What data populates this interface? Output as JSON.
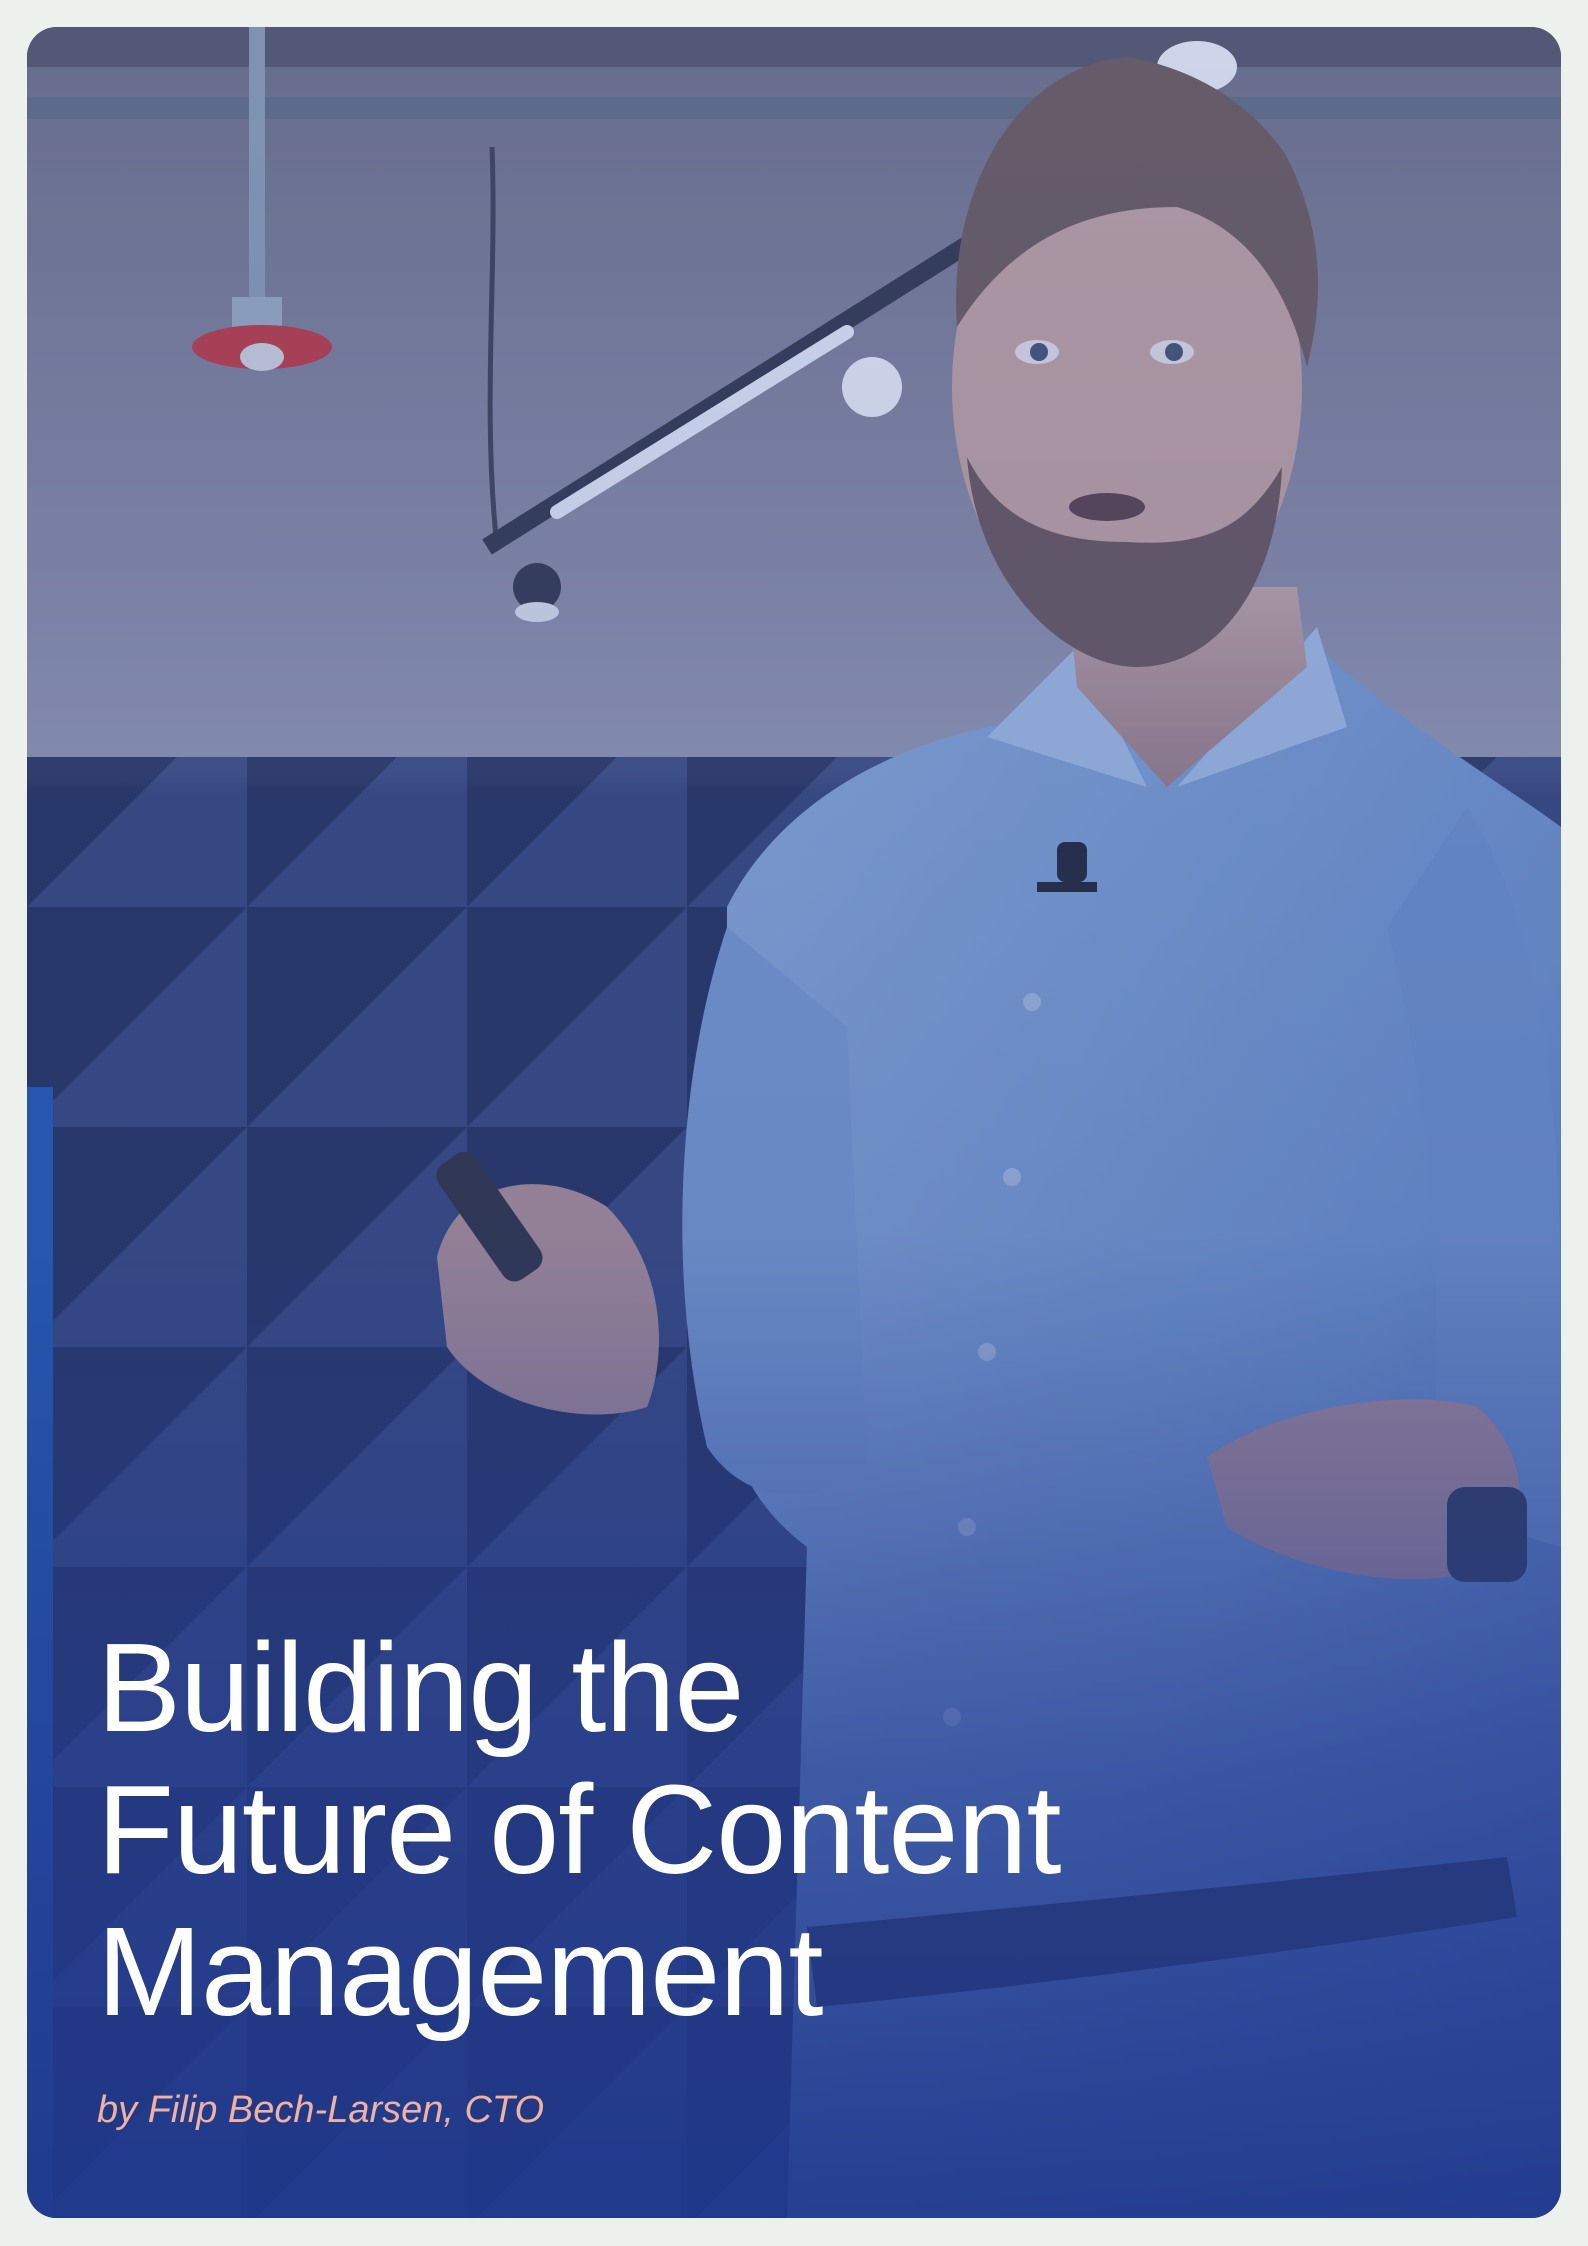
{
  "cover": {
    "title_lines": [
      "Building the",
      "Future of Content",
      "Management"
    ],
    "byline": "by Filip Bech-Larsen, CTO"
  },
  "photo": {
    "subject": "presenter-speaking",
    "overlay_color_top": "#6f7da8",
    "overlay_color_bottom": "#1f3a8d"
  },
  "colors": {
    "page_background": "#edf1ee",
    "title": "#ffffff",
    "byline": "#efb2a2",
    "shirt": "#7fa4d6"
  }
}
